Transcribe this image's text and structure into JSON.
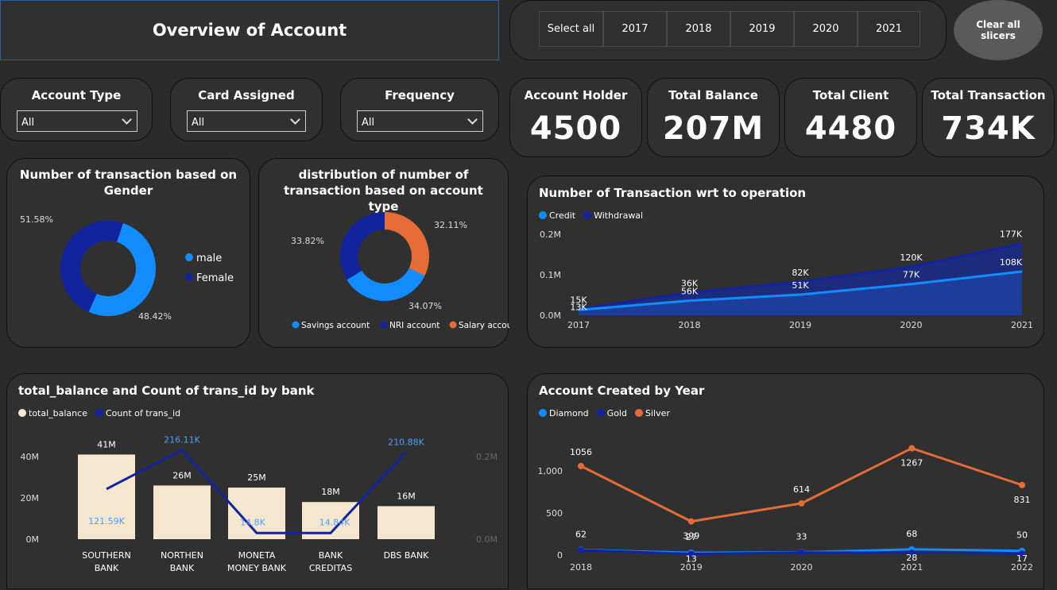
{
  "header": {
    "title": "Overview of Account"
  },
  "slicer": {
    "select_all": "Select all",
    "years": [
      "2017",
      "2018",
      "2019",
      "2020",
      "2021"
    ],
    "clear_label": "Clear all slicers"
  },
  "filters": [
    {
      "label": "Account Type",
      "value": "All"
    },
    {
      "label": "Card Assigned",
      "value": "All"
    },
    {
      "label": "Frequency",
      "value": "All"
    }
  ],
  "kpis": [
    {
      "label": "Account Holder",
      "value": "4500"
    },
    {
      "label": "Total Balance",
      "value": "207M"
    },
    {
      "label": "Total Client",
      "value": "4480"
    },
    {
      "label": "Total Transaction",
      "value": "734K"
    }
  ],
  "colors": {
    "light_blue": "#118dff",
    "dark_blue": "#12239e",
    "orange": "#e66c37",
    "cream": "#f5e6d0",
    "accent_border": "#2f5f9a"
  },
  "chart_data": [
    {
      "id": "gender",
      "type": "pie",
      "title": "Number of transaction based on Gender",
      "labels": [
        "male",
        "Female"
      ],
      "values": [
        51.58,
        48.42
      ],
      "value_labels": [
        "51.58%",
        "48.42%"
      ],
      "colors": [
        "#118dff",
        "#12239e"
      ],
      "legend": "right"
    },
    {
      "id": "account_type",
      "type": "pie",
      "title": "distribution of number of transaction based on account type",
      "labels": [
        "Savings account",
        "NRI account",
        "Salary account"
      ],
      "values": [
        34.07,
        33.82,
        32.11
      ],
      "value_labels": [
        "34.07%",
        "33.82%",
        "32.11%"
      ],
      "colors": [
        "#118dff",
        "#12239e",
        "#e66c37"
      ],
      "legend": "bottom"
    },
    {
      "id": "operation",
      "type": "area",
      "title": "Number of Transaction wrt to operation",
      "x": [
        "2017",
        "2018",
        "2019",
        "2020",
        "2021"
      ],
      "yticks": [
        "0.0M",
        "0.1M",
        "0.2M"
      ],
      "ylim": [
        0,
        200000
      ],
      "series": [
        {
          "name": "Credit",
          "values": [
            13000,
            36000,
            51000,
            77000,
            108000
          ],
          "labels": [
            "13K",
            "56K",
            "51K",
            "77K",
            "108K"
          ],
          "color": "#118dff"
        },
        {
          "name": "Withdrawal",
          "values": [
            15000,
            56000,
            82000,
            120000,
            177000
          ],
          "labels": [
            "15K",
            "36K",
            "82K",
            "120K",
            "177K"
          ],
          "color": "#12239e"
        }
      ],
      "legend": "top-left"
    },
    {
      "id": "bank",
      "type": "bar",
      "title": "total_balance and Count of trans_id by bank",
      "categories": [
        "SOUTHERN BANK",
        "NORTHEN BANK",
        "MONETA MONEY BANK",
        "BANK CREDITAS",
        "DBS BANK"
      ],
      "category_lines": [
        [
          "SOUTHERN",
          "BANK"
        ],
        [
          "NORTHEN",
          "BANK"
        ],
        [
          "MONETA",
          "MONEY BANK"
        ],
        [
          "BANK",
          "CREDITAS"
        ],
        [
          "DBS BANK"
        ]
      ],
      "yticks_left": [
        "0M",
        "20M",
        "40M"
      ],
      "yticks_right": [
        "0.0M",
        "0.2M"
      ],
      "ylim": [
        0,
        50
      ],
      "ylim_right": [
        0,
        250
      ],
      "series": [
        {
          "name": "total_balance",
          "values": [
            41,
            26,
            25,
            18,
            16
          ],
          "labels": [
            "41M",
            "26M",
            "25M",
            "18M",
            "16M"
          ],
          "color": "#f5e6d0"
        },
        {
          "name": "Count of trans_id",
          "values": [
            121.59,
            216.11,
            14.8,
            14.84,
            210.88
          ],
          "labels": [
            "121.59K",
            "216.11K",
            "14.8K",
            "14.84K",
            "210.88K"
          ],
          "color": "#12239e"
        }
      ],
      "legend": "top-left"
    },
    {
      "id": "account_created",
      "type": "line",
      "title": "Account Created by Year",
      "x": [
        "2018",
        "2019",
        "2020",
        "2021",
        "2022"
      ],
      "yticks": [
        "0",
        "500",
        "1,000"
      ],
      "ylim": [
        0,
        1300
      ],
      "series": [
        {
          "name": "Diamond",
          "values": [
            62,
            27,
            33,
            68,
            50
          ],
          "labels": [
            "62",
            "27",
            "33",
            "68",
            "50"
          ],
          "color": "#118dff"
        },
        {
          "name": "Gold",
          "values": [
            58,
            13,
            30,
            28,
            17
          ],
          "labels": [
            "",
            "13",
            "",
            "28",
            "17"
          ],
          "color": "#12239e"
        },
        {
          "name": "Silver",
          "values": [
            1056,
            399,
            614,
            1267,
            831
          ],
          "labels": [
            "1056",
            "399",
            "614",
            "1267",
            "831"
          ],
          "color": "#e66c37"
        }
      ],
      "legend": "top-left"
    }
  ]
}
